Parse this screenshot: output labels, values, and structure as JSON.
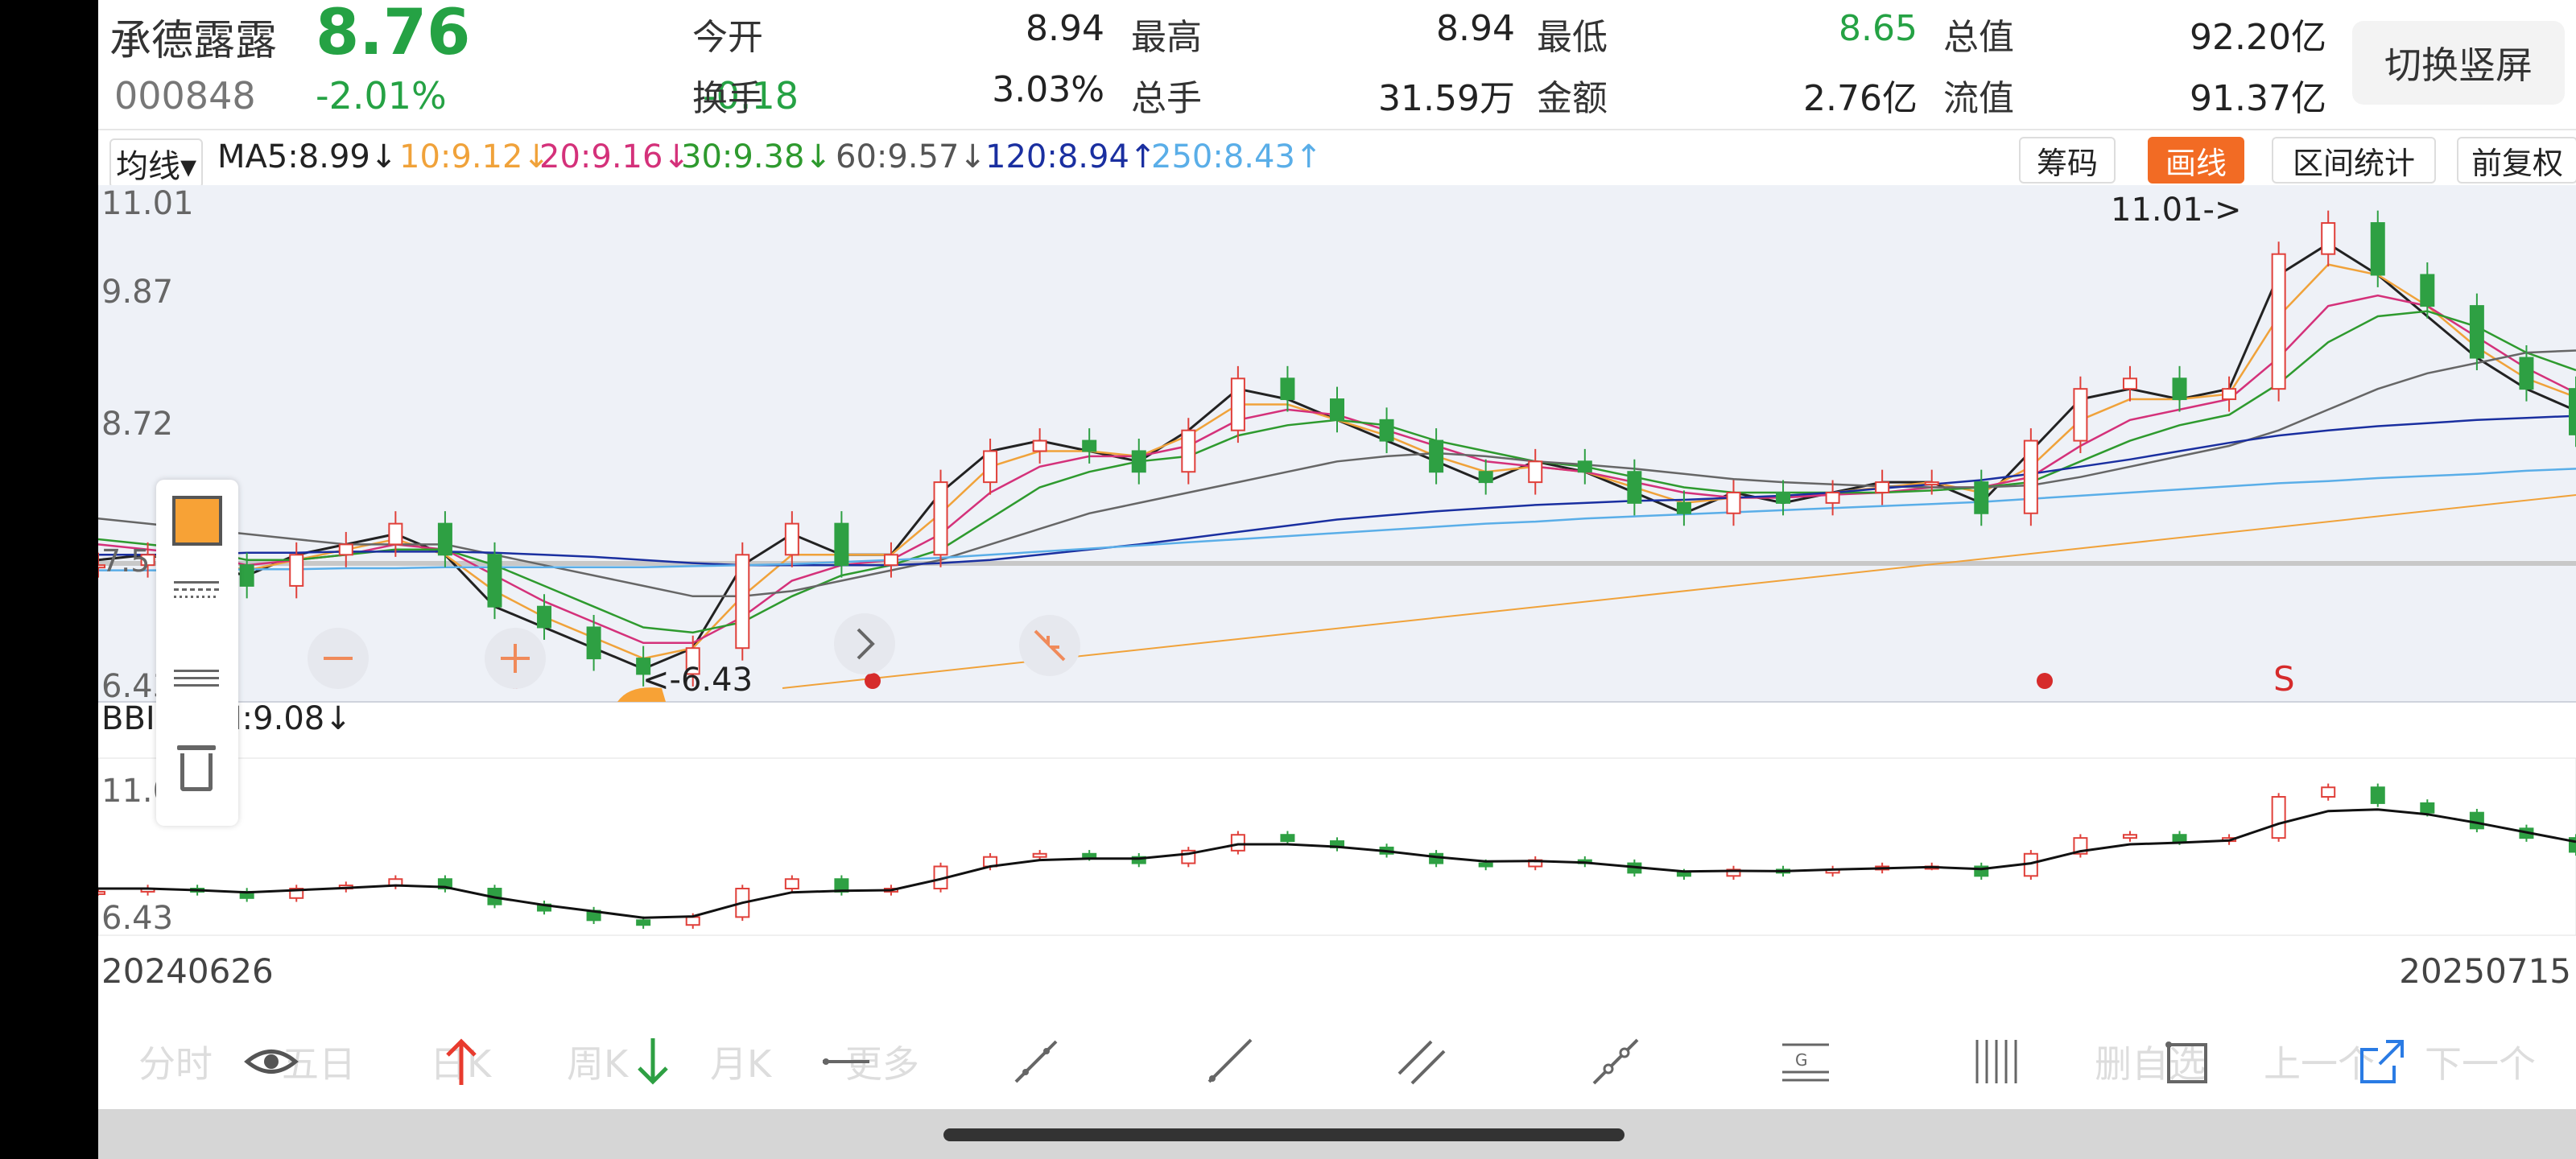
{
  "header": {
    "stock_name": "承德露露",
    "price": "8.76",
    "code": "000848",
    "change_pct": "-2.01%",
    "change": "-0.18",
    "open_label": "今开",
    "open_value": "8.94",
    "high_label": "最高",
    "high_value": "8.94",
    "low_label": "最低",
    "low_value": "8.65",
    "mktcap_label": "总值",
    "mktcap_value": "92.20亿",
    "turnover_label": "换手",
    "turnover_value": "3.03%",
    "volume_label": "总手",
    "volume_value": "31.59万",
    "amount_label": "金额",
    "amount_value": "2.76亿",
    "float_label": "流值",
    "float_value": "91.37亿",
    "rotate_button": "切换竖屏"
  },
  "mabar": {
    "dropdown": "均线▾",
    "ma5": "MA5:8.99↓",
    "ma10": "10:9.12↓",
    "ma20": "20:9.16↓",
    "ma30": "30:9.38↓",
    "ma60": "60:9.57↓",
    "ma120": "120:8.94↑",
    "ma250": "250:8.43↑",
    "tab_chips": "筹码",
    "tab_draw": "画线",
    "tab_range": "区间统计",
    "tab_adjust": "前复权",
    "colors": {
      "ma5": "#222222",
      "ma10": "#f0a23a",
      "ma20": "#d4317a",
      "ma30": "#2e9a2e",
      "ma60": "#666666",
      "ma120": "#1a2fa0",
      "ma250": "#5aaee8"
    }
  },
  "main_chart": {
    "y_labels": [
      "11.01",
      "9.87",
      "8.72",
      "6.43"
    ],
    "y_partial_label": "7.5",
    "high_annotation": "11.01->",
    "low_annotation": "<-6.43",
    "signal_mark": "S"
  },
  "sub_chart": {
    "indicator": "BBI",
    "dropdown_icon": "chevron-down-icon",
    "bbi_value": "BBI:9.08↓",
    "y_labels": [
      "11.01",
      "6.43"
    ],
    "start_date": "20240626",
    "end_date": "20250715"
  },
  "toolbar": {
    "tabs": [
      "分时",
      "五日",
      "日K",
      "周K",
      "月K",
      "更多"
    ],
    "right_texts": [
      "删自选",
      "上一个",
      "下一个"
    ],
    "icons": [
      "eye-icon",
      "up-arrow-icon",
      "down-arrow-icon",
      "horizontal-line-icon",
      "segment-icon",
      "ray-icon",
      "parallel-line-icon",
      "extend-line-icon",
      "gann-icon",
      "vertical-lines-icon",
      "rectangle-icon",
      "share-icon"
    ]
  },
  "chart_data": {
    "type": "candlestick",
    "title": "",
    "x_range": [
      "20240626",
      "20250715"
    ],
    "ylim": [
      6.43,
      11.01
    ],
    "y_ticks": [
      11.01,
      9.87,
      8.72,
      6.43
    ],
    "x": [
      0,
      2,
      4,
      6,
      8,
      10,
      12,
      14,
      16,
      18,
      20,
      22,
      24,
      26,
      28,
      30,
      32,
      34,
      36,
      38,
      40,
      42,
      44,
      46,
      48,
      50,
      52,
      54,
      56,
      58,
      60,
      62,
      64,
      66,
      68,
      70,
      72,
      74,
      76,
      78,
      80,
      82,
      84,
      86,
      88,
      90,
      92,
      94,
      96,
      98,
      100
    ],
    "close": [
      7.5,
      7.6,
      7.5,
      7.3,
      7.6,
      7.7,
      7.9,
      7.6,
      7.1,
      6.9,
      6.6,
      6.45,
      6.7,
      7.6,
      7.9,
      7.5,
      7.6,
      8.3,
      8.6,
      8.7,
      8.6,
      8.4,
      8.8,
      9.3,
      9.1,
      8.9,
      8.7,
      8.4,
      8.3,
      8.5,
      8.4,
      8.1,
      8.0,
      8.2,
      8.1,
      8.2,
      8.3,
      8.3,
      8.0,
      8.7,
      9.2,
      9.3,
      9.1,
      9.2,
      10.5,
      10.8,
      10.3,
      10.0,
      9.5,
      9.2,
      8.76
    ],
    "series": [
      {
        "name": "MA5",
        "values": [
          7.55,
          7.6,
          7.5,
          7.4,
          7.6,
          7.7,
          7.8,
          7.6,
          7.1,
          6.9,
          6.7,
          6.5,
          6.7,
          7.5,
          7.8,
          7.6,
          7.6,
          8.2,
          8.6,
          8.7,
          8.6,
          8.5,
          8.8,
          9.2,
          9.1,
          8.9,
          8.7,
          8.5,
          8.3,
          8.5,
          8.4,
          8.2,
          8.0,
          8.2,
          8.1,
          8.2,
          8.3,
          8.3,
          8.1,
          8.6,
          9.1,
          9.2,
          9.1,
          9.2,
          10.3,
          10.6,
          10.3,
          9.9,
          9.5,
          9.2,
          8.99
        ]
      },
      {
        "name": "MA10",
        "values": [
          7.6,
          7.6,
          7.55,
          7.45,
          7.55,
          7.65,
          7.75,
          7.6,
          7.25,
          7.0,
          6.8,
          6.6,
          6.7,
          7.2,
          7.6,
          7.6,
          7.6,
          8.0,
          8.45,
          8.6,
          8.6,
          8.55,
          8.75,
          9.05,
          9.05,
          8.9,
          8.75,
          8.55,
          8.4,
          8.45,
          8.4,
          8.25,
          8.1,
          8.15,
          8.15,
          8.2,
          8.25,
          8.3,
          8.2,
          8.45,
          8.9,
          9.1,
          9.1,
          9.15,
          9.9,
          10.4,
          10.3,
          10.0,
          9.6,
          9.3,
          9.12
        ]
      },
      {
        "name": "MA20",
        "values": [
          7.7,
          7.65,
          7.6,
          7.5,
          7.55,
          7.6,
          7.7,
          7.65,
          7.4,
          7.15,
          6.95,
          6.75,
          6.75,
          7.0,
          7.35,
          7.5,
          7.55,
          7.8,
          8.2,
          8.45,
          8.55,
          8.55,
          8.65,
          8.9,
          9.0,
          8.95,
          8.8,
          8.65,
          8.5,
          8.45,
          8.4,
          8.3,
          8.2,
          8.15,
          8.15,
          8.18,
          8.2,
          8.25,
          8.25,
          8.35,
          8.65,
          8.9,
          9.0,
          9.1,
          9.5,
          10.0,
          10.1,
          10.0,
          9.7,
          9.4,
          9.16
        ]
      },
      {
        "name": "MA30",
        "values": [
          7.75,
          7.7,
          7.65,
          7.55,
          7.55,
          7.6,
          7.65,
          7.65,
          7.5,
          7.3,
          7.1,
          6.9,
          6.85,
          6.95,
          7.2,
          7.4,
          7.5,
          7.65,
          7.95,
          8.25,
          8.4,
          8.5,
          8.55,
          8.75,
          8.85,
          8.9,
          8.85,
          8.7,
          8.6,
          8.5,
          8.45,
          8.35,
          8.25,
          8.2,
          8.2,
          8.2,
          8.2,
          8.22,
          8.25,
          8.3,
          8.5,
          8.7,
          8.85,
          8.95,
          9.25,
          9.65,
          9.9,
          9.95,
          9.8,
          9.55,
          9.38
        ]
      },
      {
        "name": "MA60",
        "values": [
          7.95,
          7.9,
          7.85,
          7.8,
          7.75,
          7.7,
          7.7,
          7.7,
          7.6,
          7.5,
          7.4,
          7.3,
          7.2,
          7.2,
          7.25,
          7.35,
          7.45,
          7.55,
          7.7,
          7.85,
          8.0,
          8.1,
          8.2,
          8.3,
          8.4,
          8.5,
          8.55,
          8.58,
          8.55,
          8.5,
          8.47,
          8.43,
          8.38,
          8.33,
          8.3,
          8.28,
          8.26,
          8.25,
          8.25,
          8.27,
          8.35,
          8.45,
          8.55,
          8.65,
          8.8,
          9.0,
          9.2,
          9.35,
          9.45,
          9.55,
          9.57
        ]
      },
      {
        "name": "MA120",
        "values": [
          7.6,
          7.6,
          7.6,
          7.62,
          7.62,
          7.63,
          7.63,
          7.63,
          7.62,
          7.6,
          7.58,
          7.55,
          7.52,
          7.5,
          7.5,
          7.5,
          7.5,
          7.52,
          7.55,
          7.6,
          7.65,
          7.7,
          7.76,
          7.82,
          7.88,
          7.94,
          7.98,
          8.02,
          8.05,
          8.08,
          8.1,
          8.12,
          8.13,
          8.15,
          8.17,
          8.2,
          8.24,
          8.28,
          8.32,
          8.38,
          8.45,
          8.52,
          8.6,
          8.68,
          8.75,
          8.8,
          8.84,
          8.87,
          8.9,
          8.92,
          8.94
        ]
      },
      {
        "name": "MA250",
        "values": [
          7.45,
          7.45,
          7.45,
          7.46,
          7.46,
          7.47,
          7.47,
          7.48,
          7.48,
          7.48,
          7.48,
          7.48,
          7.49,
          7.5,
          7.51,
          7.53,
          7.55,
          7.57,
          7.6,
          7.63,
          7.66,
          7.69,
          7.72,
          7.75,
          7.78,
          7.81,
          7.84,
          7.87,
          7.9,
          7.92,
          7.95,
          7.97,
          7.99,
          8.01,
          8.03,
          8.05,
          8.07,
          8.09,
          8.11,
          8.14,
          8.17,
          8.2,
          8.23,
          8.26,
          8.29,
          8.31,
          8.34,
          8.36,
          8.38,
          8.41,
          8.43
        ]
      }
    ],
    "sub_series": {
      "name": "BBI",
      "values": [
        7.6,
        7.6,
        7.55,
        7.48,
        7.55,
        7.62,
        7.7,
        7.65,
        7.32,
        7.08,
        6.88,
        6.68,
        6.72,
        7.15,
        7.48,
        7.53,
        7.55,
        7.9,
        8.3,
        8.5,
        8.55,
        8.55,
        8.7,
        9.0,
        9.0,
        8.92,
        8.78,
        8.6,
        8.46,
        8.47,
        8.42,
        8.28,
        8.14,
        8.16,
        8.15,
        8.2,
        8.24,
        8.28,
        8.22,
        8.4,
        8.78,
        9.0,
        9.05,
        9.12,
        9.65,
        10.05,
        10.1,
        9.95,
        9.68,
        9.38,
        9.08
      ]
    }
  }
}
